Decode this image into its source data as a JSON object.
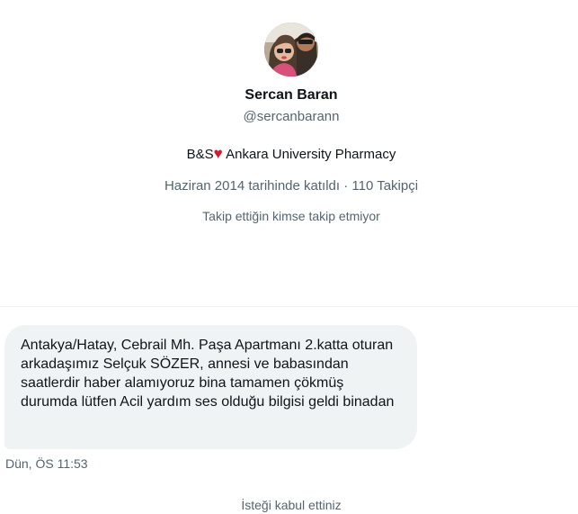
{
  "profile": {
    "name": "Sercan Baran",
    "handle": "@sercanbarann",
    "bio_prefix": "B&S",
    "bio_heart": "♥",
    "bio_suffix": " Ankara University Pharmacy",
    "meta": "Haziran 2014 tarihinde katıldı · 110 Takipçi",
    "mutual_info": "Takip ettiğin kimse takip etmiyor"
  },
  "message": {
    "text": "Antakya/Hatay, Cebrail Mh. Paşa Apartmanı 2.katta oturan arkadaşımız Selçuk SÖZER, annesi ve babasından saatlerdir haber alamıyoruz bina tamamen çökmüş durumda lütfen Acil yardım ses olduğu bilgisi geldi binadan",
    "timestamp": "Dün, ÖS 11:53"
  },
  "status": {
    "request_accepted": "İsteği kabul ettiniz"
  },
  "colors": {
    "text": "#0f1419",
    "secondary": "#536471",
    "bubble": "#eff3f4",
    "heart": "#d01a34"
  }
}
